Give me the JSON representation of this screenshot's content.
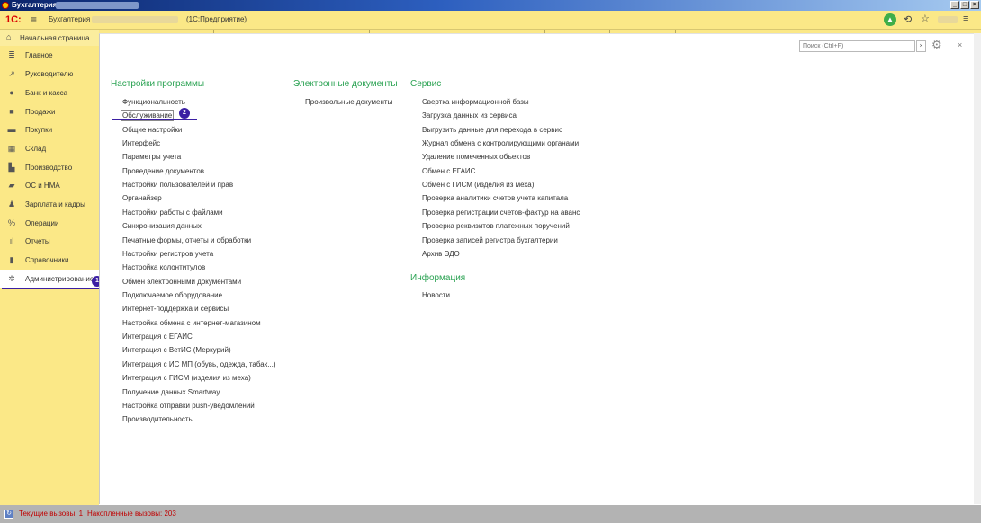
{
  "window": {
    "title": "Бухгалтерия",
    "minimize": "_",
    "restore": "□",
    "close": "×"
  },
  "app_header": {
    "logo": "1С:",
    "app_name": "Бухгалтерия",
    "platform": "(1С:Предприятие)",
    "icons": [
      "menu-icon",
      "notifications-icon",
      "history-icon",
      "favorites-icon",
      "main-menu-icon"
    ]
  },
  "sidebar": {
    "home": "Начальная страница",
    "items": [
      {
        "label": "Главное",
        "icon": "list-icon"
      },
      {
        "label": "Руководителю",
        "icon": "trend-icon"
      },
      {
        "label": "Банк и касса",
        "icon": "bank-icon"
      },
      {
        "label": "Продажи",
        "icon": "bag-icon"
      },
      {
        "label": "Покупки",
        "icon": "cart-icon"
      },
      {
        "label": "Склад",
        "icon": "warehouse-icon"
      },
      {
        "label": "Производство",
        "icon": "factory-icon"
      },
      {
        "label": "ОС и НМА",
        "icon": "truck-icon"
      },
      {
        "label": "Зарплата и кадры",
        "icon": "person-icon"
      },
      {
        "label": "Операции",
        "icon": "operations-icon"
      },
      {
        "label": "Отчеты",
        "icon": "report-icon"
      },
      {
        "label": "Справочники",
        "icon": "book-icon"
      },
      {
        "label": "Администрирование",
        "icon": "gear-icon",
        "active": true
      }
    ]
  },
  "annotations": {
    "badge1": "1",
    "badge2": "2"
  },
  "search": {
    "placeholder": "Поиск (Ctrl+F)",
    "clear": "×"
  },
  "content": {
    "close": "×",
    "sections": [
      {
        "title": "Настройки программы",
        "items": [
          "Функциональность",
          "Обслуживание",
          "Общие настройки",
          "Интерфейс",
          "Параметры учета",
          "Проведение документов",
          "Настройки пользователей и прав",
          "Органайзер",
          "Настройки работы с файлами",
          "Синхронизация данных",
          "Печатные формы, отчеты и обработки",
          "Настройки регистров учета",
          "Настройка колонтитулов",
          "Обмен электронными документами",
          "Подключаемое оборудование",
          "Интернет-поддержка и сервисы",
          "Настройка обмена с интернет-магазином",
          "Интеграция с ЕГАИС",
          "Интеграция с ВетИС (Меркурий)",
          "Интеграция с ИС МП (обувь, одежда, табак...)",
          "Интеграция с ГИСМ (изделия из меха)",
          "Получение данных Smartway",
          "Настройка отправки push-уведомлений",
          "Производительность"
        ]
      },
      {
        "title": "Электронные документы",
        "items": [
          "Произвольные документы"
        ]
      },
      {
        "title": "Сервис",
        "items": [
          "Свертка информационной базы",
          "Загрузка данных из сервиса",
          "Выгрузить данные для перехода в сервис",
          "Журнал обмена с контролирующими органами",
          "Удаление помеченных объектов",
          "Обмен с ЕГАИС",
          "Обмен с ГИСМ (изделия из меха)",
          "Проверка аналитики счетов учета капитала",
          "Проверка регистрации счетов-фактур на аванс",
          "Проверка реквизитов платежных поручений",
          "Проверка записей регистра бухгалтерии",
          "Архив ЭДО"
        ]
      },
      {
        "title": "Информация",
        "items": [
          "Новости"
        ]
      }
    ]
  },
  "status": {
    "current_calls": "Текущие вызовы: 1",
    "accumulated_calls": "Накопленные вызовы: 203"
  }
}
